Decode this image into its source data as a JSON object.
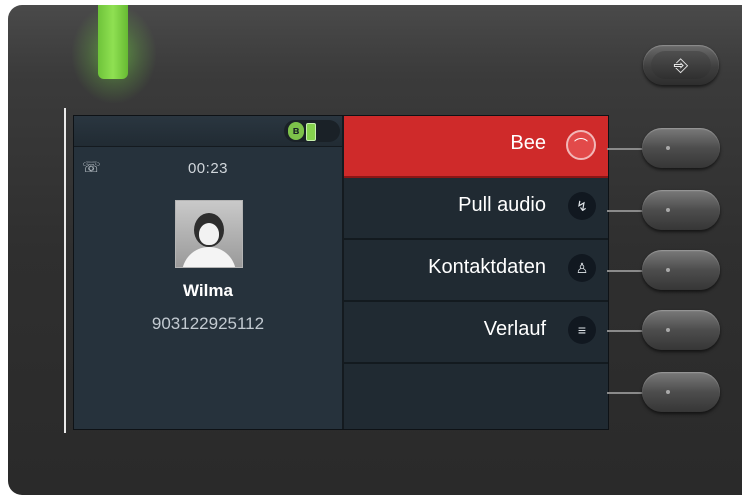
{
  "device": {
    "led_color": "#7dd347",
    "exit_button_icon": "exit-icon",
    "exit_button_glyph": "⎆"
  },
  "status_bar": {
    "bluetooth_icon": "bluetooth-icon",
    "bluetooth_glyph": "ʙ",
    "battery_icon": "battery-icon"
  },
  "call": {
    "call_icon": "handset-call-icon",
    "call_icon_glyph": "☏",
    "timer": "00:23",
    "caller_name": "Wilma",
    "caller_number": "903122925112"
  },
  "menu": {
    "items": [
      {
        "label": "Bee",
        "icon": "hangup-icon",
        "glyph": "⌒",
        "active": true
      },
      {
        "label": "Pull audio",
        "icon": "pull-audio-icon",
        "glyph": "↯",
        "active": false
      },
      {
        "label": "Kontaktdaten",
        "icon": "contact-icon",
        "glyph": "♙",
        "active": false
      },
      {
        "label": "Verlauf",
        "icon": "history-list-icon",
        "glyph": "≡",
        "active": false
      },
      {
        "label": "",
        "icon": "",
        "glyph": "",
        "active": false
      }
    ]
  },
  "colors": {
    "active_menu": "#cf2a2a",
    "screen_bg": "#1e262d",
    "accent_green": "#7dc24a"
  }
}
